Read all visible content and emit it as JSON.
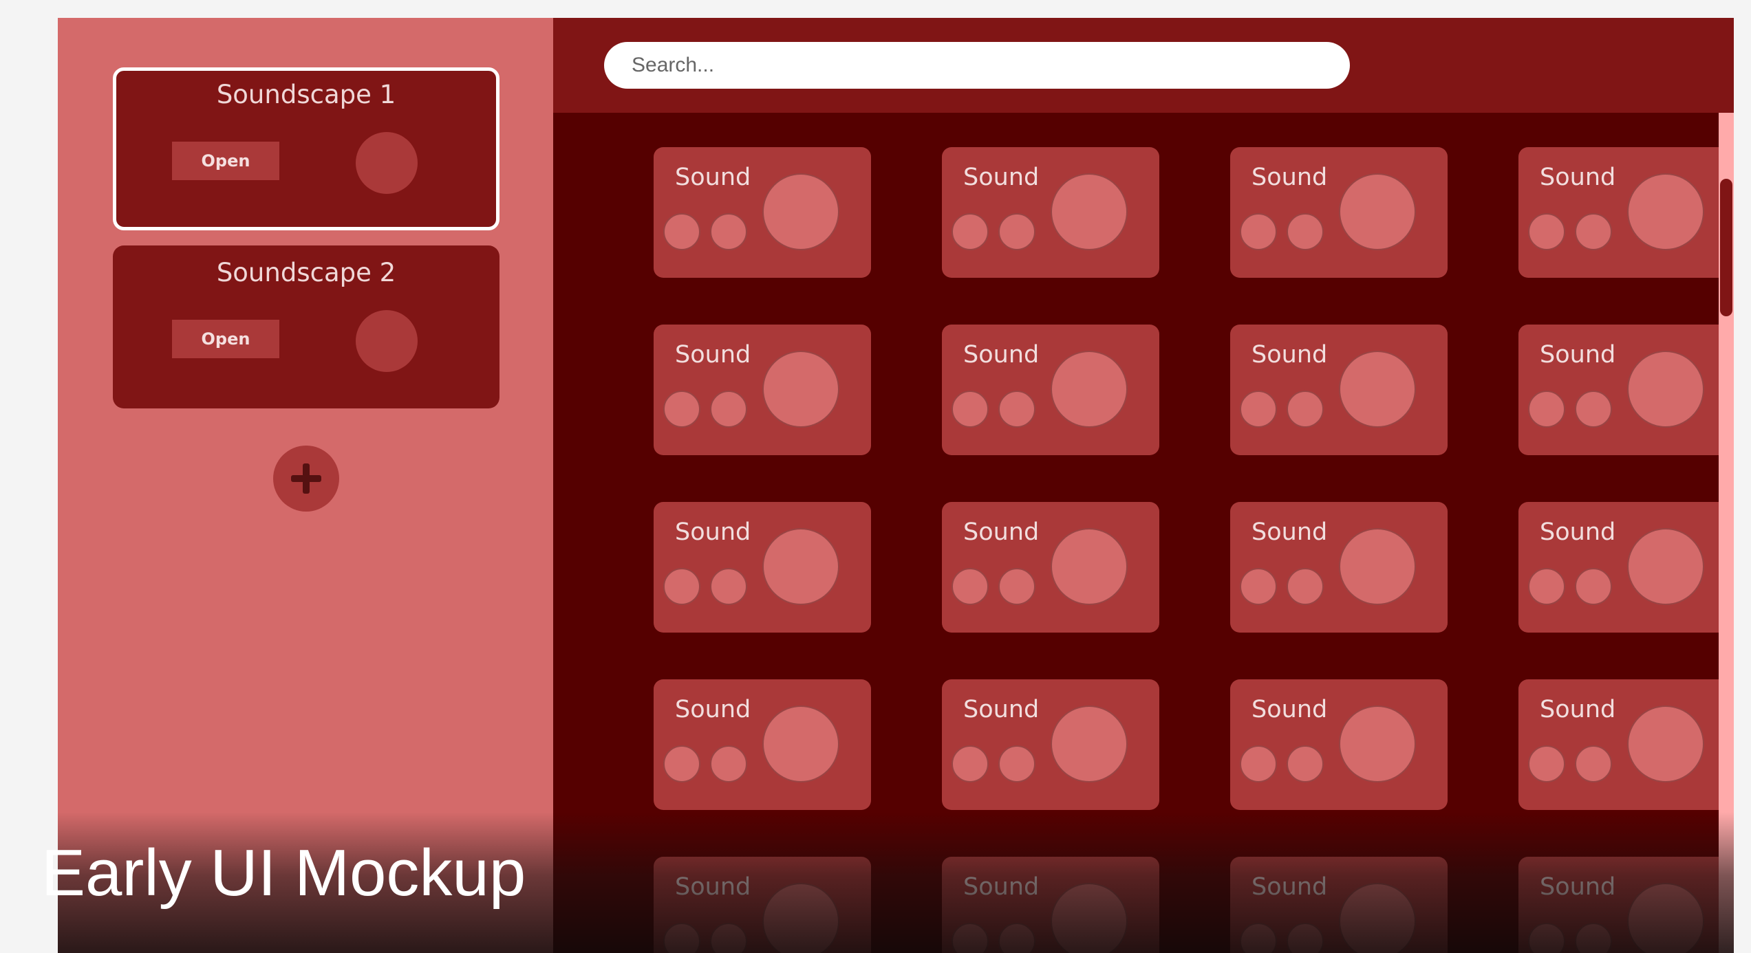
{
  "sidebar": {
    "soundscapes": [
      {
        "title": "Soundscape 1",
        "open_label": "Open",
        "active": true
      },
      {
        "title": "Soundscape 2",
        "open_label": "Open",
        "active": false
      }
    ],
    "add_icon": "plus-icon"
  },
  "header": {
    "search_placeholder": "Search..."
  },
  "sound_tiles": {
    "label": "Sound",
    "columns": 4,
    "rows_visible": 5
  },
  "caption": "Early UI Mockup",
  "colors": {
    "page_bg": "#f4f4f4",
    "sidebar_bg": "#d46a6a",
    "card_bg": "#801515",
    "accent": "#aa3939",
    "main_bg": "#550000",
    "control_fill": "#d46a6a",
    "scrollbar_track": "#ffaaaa"
  }
}
